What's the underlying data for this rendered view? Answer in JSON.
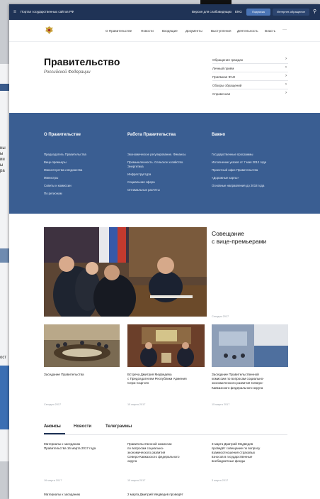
{
  "topbar": {
    "site_label": "Портал государственных сайтов РФ",
    "accessibility": "Версия для слабовидящих",
    "lang": "ENG",
    "login": "Подписка",
    "feedback": "Интернет-обращение"
  },
  "nav": {
    "items": [
      "О Правительстве",
      "Новости",
      "Входящие",
      "Документы",
      "Выступления",
      "Деятельность",
      "Власть"
    ],
    "more": "···"
  },
  "header": {
    "title": "Правительство",
    "subtitle": "Российской Федерации",
    "links": [
      "Обращения граждан",
      "Личный приём",
      "Приёмная ФАО",
      "Обзоры обращений",
      "Справочная"
    ]
  },
  "columns": [
    {
      "title": "О Правительстве",
      "links": [
        "Председатель Правительства",
        "Вице-премьеры",
        "Министерства и ведомства",
        "Министры",
        "Советы и комиссии",
        "По регионам"
      ]
    },
    {
      "title": "Работа Правительства",
      "links": [
        "Экономическое регулирование. Финансы",
        "Промышленность. Сельское хозяйство. Энергетика",
        "Инфраструктура",
        "Социальная сфера",
        "Оптимальные расчёты"
      ]
    },
    {
      "title": "Важно",
      "links": [
        "Государственные программы",
        "Исполнение указов от 7 мая 2012 года",
        "Проектный офис Правительства",
        "«Дорожные карты»",
        "Основные направления до 2018 года"
      ]
    }
  ],
  "featured": {
    "title": "Совещание\nс вице-премьерами",
    "date": "Сегодня 2017"
  },
  "cards": [
    {
      "caption": "Заседание Правительства",
      "date": "Сегодня 2017"
    },
    {
      "caption": "Встреча Дмитрия Медведева\nс Председателем Республики Армения\nСерж Саргсян",
      "date": "15 марта 2017"
    },
    {
      "caption": "Заседание Правительственной\nкомиссии по вопросам социально-\nэкономического развития Северо-\nКавказского федерального округа",
      "date": "15 марта 2017"
    }
  ],
  "tabs": [
    "Анонсы",
    "Новости",
    "Телеграммы"
  ],
  "news": [
    {
      "text": "Материалы к заседанию\nПравительства 16 марта 2017 года",
      "date": "16 марта 2017"
    },
    {
      "text": "Правительственной комиссии\nпо вопросам социально-\nэкономического развития\nСеверо-Кавказского федерального\nокруга",
      "date": "15 марта 2017"
    },
    {
      "text": "3 марта Дмитрий Медведев\nпроведёт совещание по вопросу\nвзаимоотношения страховых\nвзносов в государственные\nвнебюджетные фонды",
      "date": "3 марта 2017"
    }
  ],
  "news_more": [
    {
      "text": "Материалы к заседанию"
    },
    {
      "text": "2 марта Дмитрий Медведев проведёт"
    }
  ],
  "colors": {
    "topbar": "#1f3356",
    "blue_section": "#3a5e92",
    "accent": "#4a74b5"
  }
}
